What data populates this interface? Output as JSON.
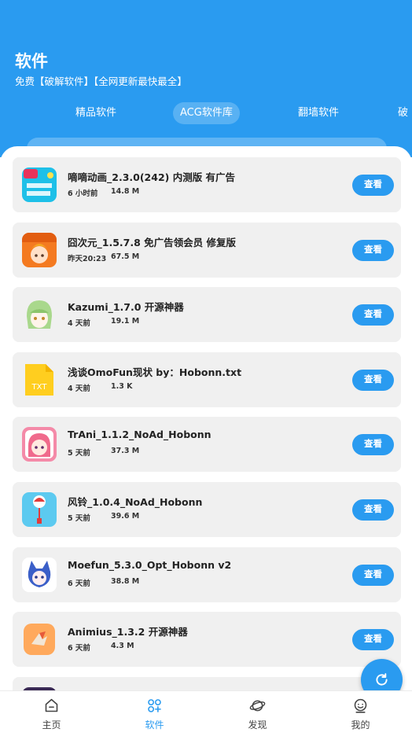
{
  "header": {
    "title": "软件",
    "subtitle": "免费【破解软件】【全网更新最快最全】"
  },
  "tabs": [
    {
      "label": "精品软件",
      "active": false
    },
    {
      "label": "ACG软件库",
      "active": true
    },
    {
      "label": "翻墙软件",
      "active": false
    },
    {
      "label": "破",
      "active": false
    }
  ],
  "items": [
    {
      "title": "嘀嘀动画_2.3.0(242) 内测版 有广告",
      "time": "6 小时前",
      "size": "14.8 M",
      "button": "查看",
      "icon": "didi-anime-icon"
    },
    {
      "title": "囧次元_1.5.7.8 免广告领会员 修复版",
      "time": "昨天20:23",
      "size": "67.5 M",
      "button": "查看",
      "icon": "jiongciyuan-icon"
    },
    {
      "title": "Kazumi_1.7.0 开源神器",
      "time": "4 天前",
      "size": "19.1 M",
      "button": "查看",
      "icon": "kazumi-icon"
    },
    {
      "title": "浅谈OmoFun现状 by：Hobonn.txt",
      "time": "4 天前",
      "size": "1.3 K",
      "button": "查看",
      "icon": "txt-file-icon",
      "icon_text": "TXT"
    },
    {
      "title": "TrAni_1.1.2_NoAd_Hobonn",
      "time": "5 天前",
      "size": "37.3 M",
      "button": "查看",
      "icon": "trani-icon"
    },
    {
      "title": "风铃_1.0.4_NoAd_Hobonn",
      "time": "5 天前",
      "size": "39.6 M",
      "button": "查看",
      "icon": "fengling-icon"
    },
    {
      "title": "Moefun_5.3.0_Opt_Hobonn v2",
      "time": "6 天前",
      "size": "38.8 M",
      "button": "查看",
      "icon": "moefun-icon"
    },
    {
      "title": "Animius_1.3.2 开源神器",
      "time": "6 天前",
      "size": "4.3 M",
      "button": "查看",
      "icon": "animius-icon"
    }
  ],
  "bottom_nav": [
    {
      "label": "主页",
      "icon": "home-icon",
      "active": false
    },
    {
      "label": "软件",
      "icon": "apps-icon",
      "active": true
    },
    {
      "label": "发现",
      "icon": "planet-icon",
      "active": false
    },
    {
      "label": "我的",
      "icon": "profile-icon",
      "active": false
    }
  ],
  "colors": {
    "accent": "#2a9bf0",
    "card": "#f0f0f0"
  }
}
